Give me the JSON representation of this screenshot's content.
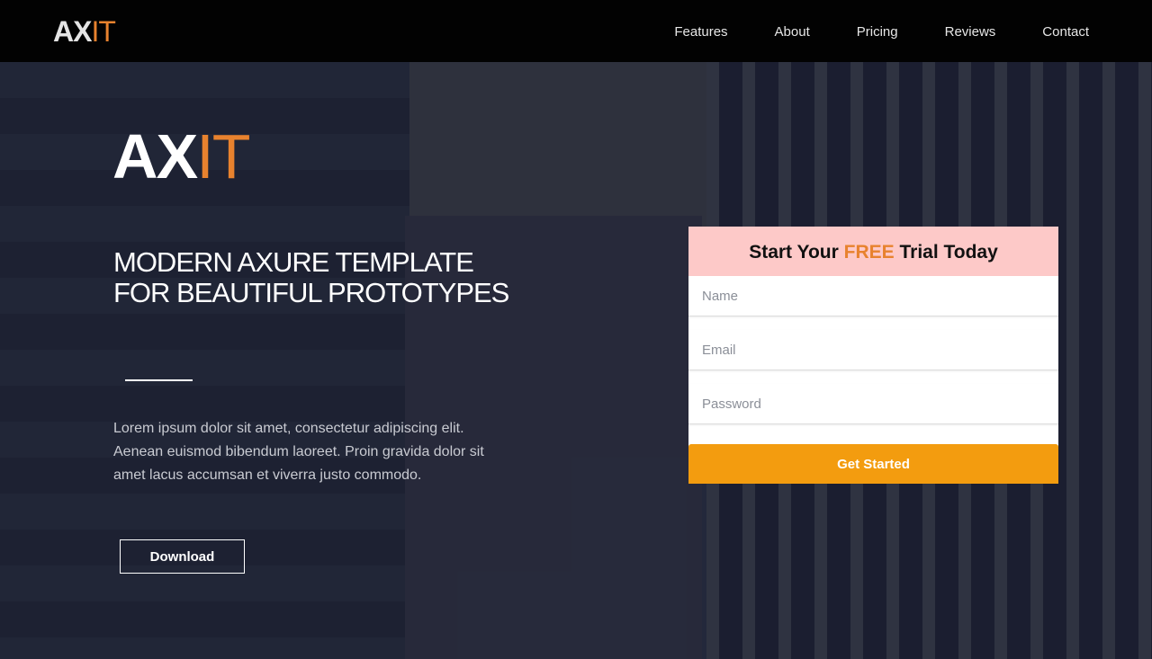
{
  "brand": {
    "logo_a": "AX",
    "logo_b": "IT"
  },
  "nav": {
    "items": [
      "Features",
      "About",
      "Pricing",
      "Reviews",
      "Contact"
    ]
  },
  "hero": {
    "headline": "MODERN AXURE TEMPLATE FOR BEAUTIFUL PROTOTYPES",
    "paragraph": "Lorem ipsum dolor sit amet, consectetur adipiscing elit. Aenean euismod bibendum laoreet. Proin gravida dolor sit amet lacus accumsan et viverra justo commodo.",
    "download_label": "Download"
  },
  "form": {
    "title_pre": "Start Your ",
    "title_highlight": "FREE",
    "title_post": " Trial Today",
    "name_placeholder": "Name",
    "email_placeholder": "Email",
    "password_placeholder": "Password",
    "submit_label": "Get Started"
  },
  "colors": {
    "accent": "#e8822e",
    "button": "#f39c0f",
    "form_header": "#fdc9c8"
  }
}
